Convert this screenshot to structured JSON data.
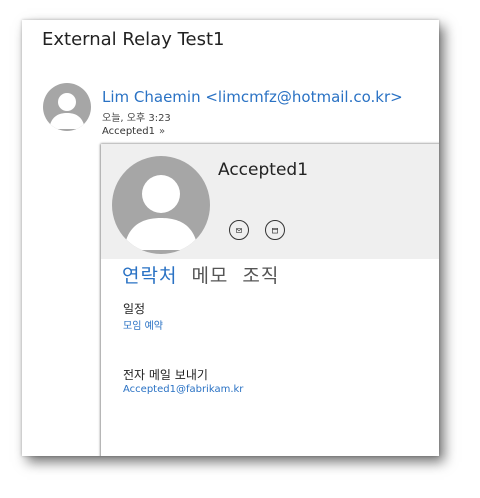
{
  "message": {
    "subject": "External Relay Test1",
    "from": "Lim Chaemin <limcmfz@hotmail.co.kr>",
    "time": "오늘, 오후 3:23",
    "to": "Accepted1",
    "to_expand_icon": "chevron-down-double-icon"
  },
  "contact_card": {
    "name": "Accepted1",
    "actions": [
      {
        "icon": "email-icon"
      },
      {
        "icon": "calendar-icon"
      }
    ],
    "tabs": [
      {
        "label": "연락처",
        "active": true
      },
      {
        "label": "메모",
        "active": false
      },
      {
        "label": "조직",
        "active": false
      }
    ],
    "schedule_label": "일정",
    "schedule_link": "모임 예약",
    "email_label": "전자 메일 보내기",
    "email_value": "Accepted1@fabrikam.kr"
  },
  "colors": {
    "accent": "#2a72c4",
    "avatar": "#a6a6a6",
    "card_header": "#efefef"
  }
}
